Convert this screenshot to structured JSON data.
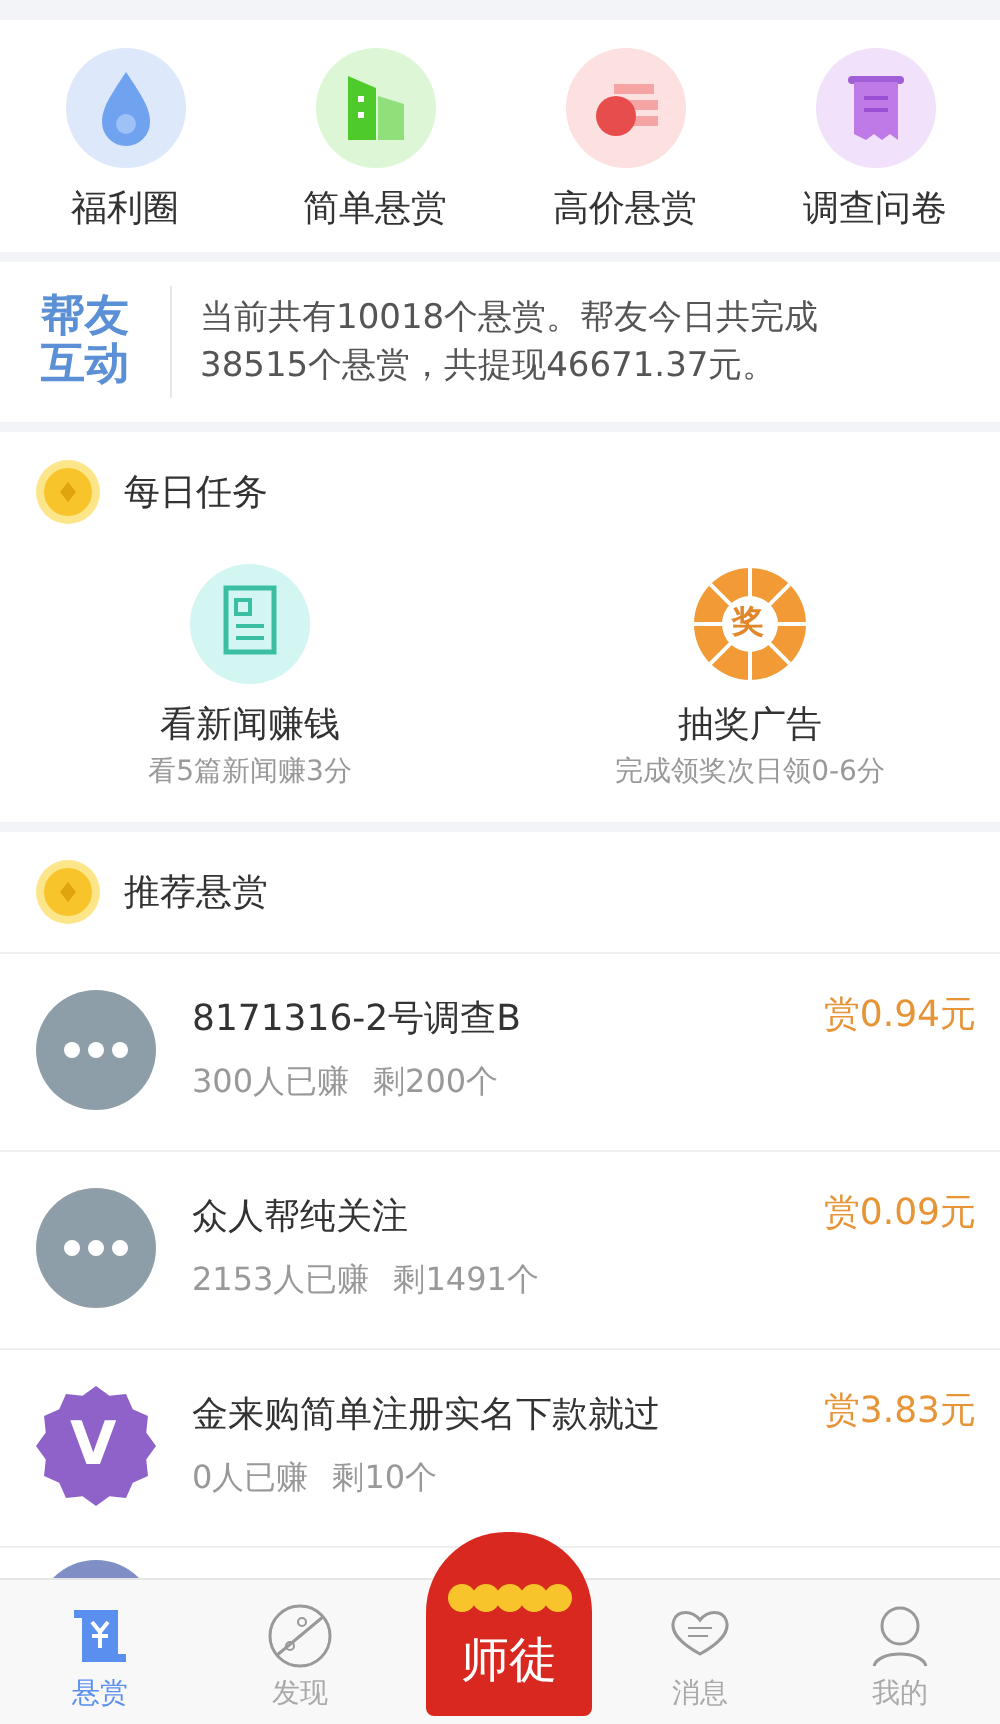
{
  "categories": [
    {
      "label": "福利圈",
      "kind": "drop"
    },
    {
      "label": "简单悬赏",
      "kind": "buildings"
    },
    {
      "label": "高价悬赏",
      "kind": "money"
    },
    {
      "label": "调查问卷",
      "kind": "receipt"
    }
  ],
  "banner": {
    "logo_top": "帮友",
    "logo_bottom": "互动",
    "text": "当前共有10018个悬赏。帮友今日共完成38515个悬赏，共提现46671.37元。"
  },
  "daily_tasks": {
    "title": "每日任务",
    "items": [
      {
        "kind": "news",
        "title": "看新闻赚钱",
        "subtitle": "看5篇新闻赚3分"
      },
      {
        "kind": "wheel",
        "title": "抽奖广告",
        "wheel_label": "奖",
        "subtitle": "完成领奖次日领0-6分"
      }
    ]
  },
  "recommended": {
    "title": "推荐悬赏",
    "items": [
      {
        "kind": "dots",
        "title": "8171316-2号调查B",
        "earned": "300人已赚",
        "left": "剩200个",
        "reward": "赏0.94元"
      },
      {
        "kind": "dots",
        "title": "众人帮纯关注",
        "earned": "2153人已赚",
        "left": "剩1491个",
        "reward": "赏0.09元"
      },
      {
        "kind": "badge",
        "badge_letter": "V",
        "title": "金来购简单注册实名下款就过",
        "earned": "0人已赚",
        "left": "剩10个",
        "reward": "赏3.83元"
      },
      {
        "kind": "plain"
      }
    ]
  },
  "tab_bar": [
    {
      "label": "悬赏",
      "kind": "scroll",
      "selected": true
    },
    {
      "label": "发现",
      "kind": "planet",
      "selected": false
    },
    {
      "label": "师徒",
      "kind": "envelope",
      "selected": false
    },
    {
      "label": "消息",
      "kind": "chat",
      "selected": false
    },
    {
      "label": "我的",
      "kind": "person",
      "selected": false
    }
  ]
}
